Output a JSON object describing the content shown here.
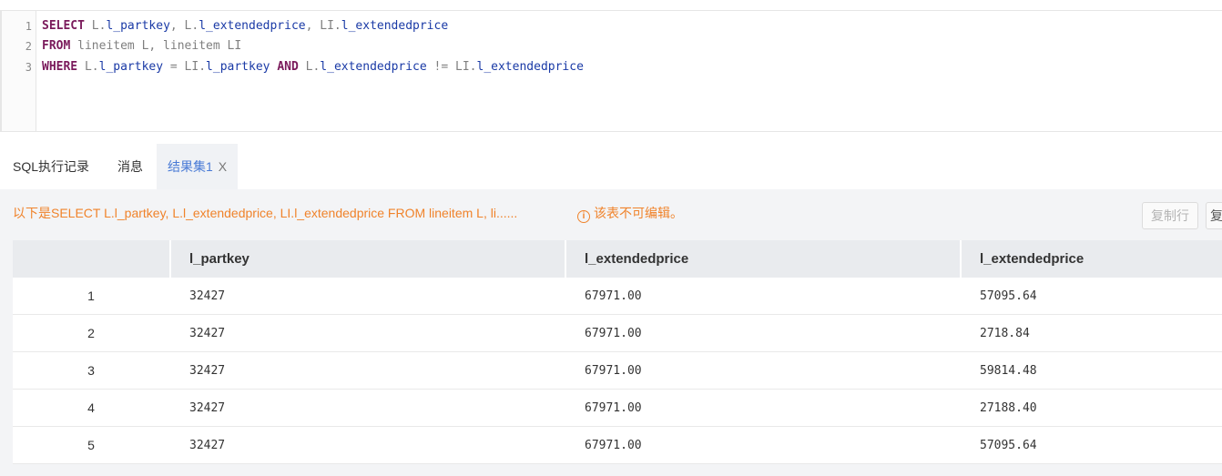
{
  "editor": {
    "line_numbers": [
      "1",
      "2",
      "3"
    ],
    "line1": {
      "kw_select": "SELECT",
      "part1": " L.",
      "f1": "l_partkey",
      "part2": ", L.",
      "f2": "l_extendedprice",
      "part3": ", LI.",
      "f3": "l_extendedprice"
    },
    "line2": {
      "kw_from": "FROM",
      "rest": " lineitem L, lineitem LI"
    },
    "line3": {
      "kw_where": "WHERE",
      "p1": " L.",
      "f1": "l_partkey",
      "p2": " = LI.",
      "f2": "l_partkey",
      "kw_and": " AND",
      "p3": " L.",
      "f3": "l_extendedprice",
      "p4": " != LI.",
      "f4": "l_extendedprice"
    }
  },
  "tabs": {
    "history": "SQL执行记录",
    "messages": "消息",
    "result": "结果集1",
    "close": "X"
  },
  "result_panel": {
    "info": "以下是SELECT L.l_partkey, L.l_extendedprice, LI.l_extendedprice FROM lineitem L, li......",
    "warning": "该表不可编辑。",
    "warning_icon": "i",
    "copy_row_button": "复制行",
    "copy_button_partial": "复"
  },
  "table": {
    "headers": [
      "",
      "l_partkey",
      "l_extendedprice",
      "l_extendedprice"
    ],
    "rows": [
      [
        "1",
        "32427",
        "67971.00",
        "57095.64"
      ],
      [
        "2",
        "32427",
        "67971.00",
        "2718.84"
      ],
      [
        "3",
        "32427",
        "67971.00",
        "59814.48"
      ],
      [
        "4",
        "32427",
        "67971.00",
        "27188.40"
      ],
      [
        "5",
        "32427",
        "67971.00",
        "57095.64"
      ]
    ]
  },
  "colors": {
    "keyword": "#7a1a5b",
    "field": "#1a3aa6",
    "warning": "#f0832b",
    "active_tab": "#4a7bd6"
  }
}
